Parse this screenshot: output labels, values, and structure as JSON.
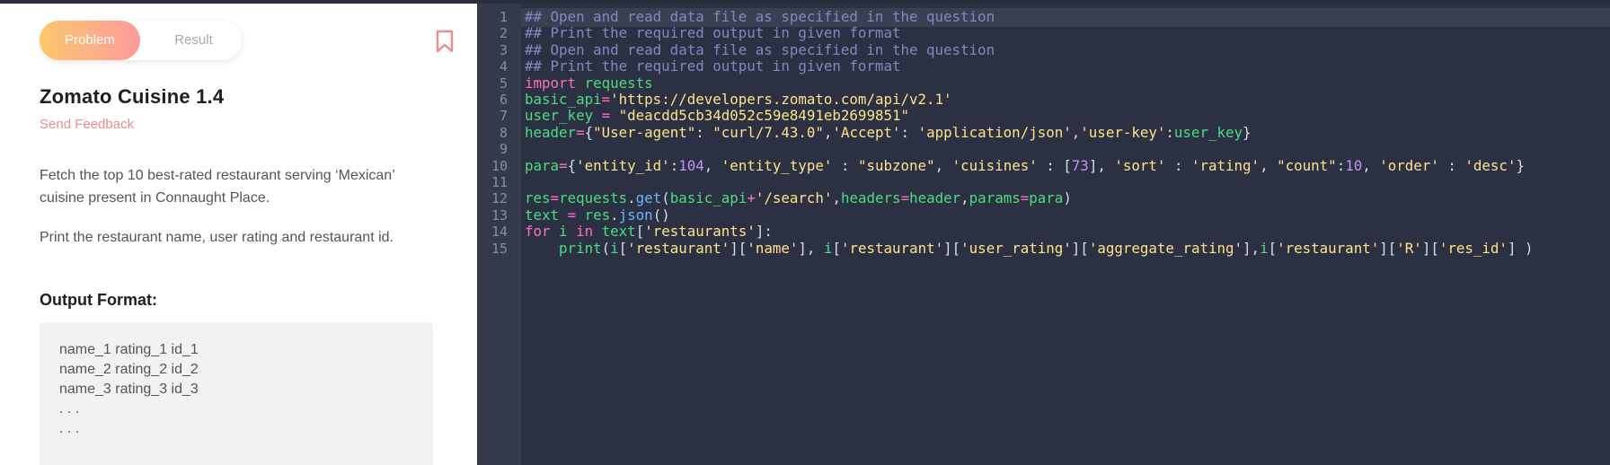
{
  "problem": {
    "tabs": {
      "problem": "Problem",
      "result": "Result"
    },
    "title": "Zomato Cuisine 1.4",
    "feedback": "Send Feedback",
    "description": [
      "Fetch the top 10 best-rated restaurant serving ‘Mexican’ cuisine present in Connaught Place.",
      "Print the restaurant name, user rating and restaurant id."
    ],
    "output_heading": "Output Format:",
    "output_lines": [
      "name_1 rating_1 id_1",
      "name_2 rating_2 id_2",
      "name_3 rating_3 id_3",
      ". . .",
      ". . ."
    ]
  },
  "editor": {
    "line_numbers": [
      "1",
      "2",
      "3",
      "4",
      "5",
      "6",
      "7",
      "8",
      "9",
      "10",
      "11",
      "12",
      "13",
      "14",
      "15"
    ],
    "lines": [
      [
        {
          "t": "## Open and read data file as specified in the question",
          "c": "cm"
        }
      ],
      [
        {
          "t": "## Print the required output in given format",
          "c": "cm"
        }
      ],
      [
        {
          "t": "## Open and read data file as specified in the question",
          "c": "cm"
        }
      ],
      [
        {
          "t": "## Print the required output in given format",
          "c": "cm"
        }
      ],
      [
        {
          "t": "import",
          "c": "kw"
        },
        {
          "t": " requests",
          "c": "nm"
        }
      ],
      [
        {
          "t": "basic_api",
          "c": "nm"
        },
        {
          "t": "=",
          "c": "op"
        },
        {
          "t": "'https://developers.zomato.com/api/v2.1'",
          "c": "st"
        }
      ],
      [
        {
          "t": "user_key ",
          "c": "nm"
        },
        {
          "t": "=",
          "c": "op"
        },
        {
          "t": " \"deacdd5cb34d052c59e8491eb2699851\"",
          "c": "st"
        }
      ],
      [
        {
          "t": "header",
          "c": "nm"
        },
        {
          "t": "=",
          "c": "op"
        },
        {
          "t": "{",
          "c": "pl"
        },
        {
          "t": "\"User-agent\"",
          "c": "st"
        },
        {
          "t": ": ",
          "c": "pl"
        },
        {
          "t": "\"curl/7.43.0\"",
          "c": "st"
        },
        {
          "t": ",",
          "c": "pl"
        },
        {
          "t": "'Accept'",
          "c": "st"
        },
        {
          "t": ": ",
          "c": "pl"
        },
        {
          "t": "'application/json'",
          "c": "st"
        },
        {
          "t": ",",
          "c": "pl"
        },
        {
          "t": "'user-key'",
          "c": "st"
        },
        {
          "t": ":",
          "c": "pl"
        },
        {
          "t": "user_key",
          "c": "nm"
        },
        {
          "t": "}",
          "c": "pl"
        }
      ],
      [],
      [
        {
          "t": "para",
          "c": "nm"
        },
        {
          "t": "=",
          "c": "op"
        },
        {
          "t": "{",
          "c": "pl"
        },
        {
          "t": "'entity_id'",
          "c": "st"
        },
        {
          "t": ":",
          "c": "pl"
        },
        {
          "t": "104",
          "c": "nu"
        },
        {
          "t": ", ",
          "c": "pl"
        },
        {
          "t": "'entity_type'",
          "c": "st"
        },
        {
          "t": " : ",
          "c": "pl"
        },
        {
          "t": "\"subzone\"",
          "c": "st"
        },
        {
          "t": ", ",
          "c": "pl"
        },
        {
          "t": "'cuisines'",
          "c": "st"
        },
        {
          "t": " : [",
          "c": "pl"
        },
        {
          "t": "73",
          "c": "nu"
        },
        {
          "t": "], ",
          "c": "pl"
        },
        {
          "t": "'sort'",
          "c": "st"
        },
        {
          "t": " : ",
          "c": "pl"
        },
        {
          "t": "'rating'",
          "c": "st"
        },
        {
          "t": ", ",
          "c": "pl"
        },
        {
          "t": "\"count\"",
          "c": "st"
        },
        {
          "t": ":",
          "c": "pl"
        },
        {
          "t": "10",
          "c": "nu"
        },
        {
          "t": ", ",
          "c": "pl"
        },
        {
          "t": "'order'",
          "c": "st"
        },
        {
          "t": " : ",
          "c": "pl"
        },
        {
          "t": "'desc'",
          "c": "st"
        },
        {
          "t": "}",
          "c": "pl"
        }
      ],
      [],
      [
        {
          "t": "res",
          "c": "nm"
        },
        {
          "t": "=",
          "c": "op"
        },
        {
          "t": "requests",
          "c": "nm"
        },
        {
          "t": ".",
          "c": "pl"
        },
        {
          "t": "get",
          "c": "fn"
        },
        {
          "t": "(",
          "c": "pl"
        },
        {
          "t": "basic_api",
          "c": "nm"
        },
        {
          "t": "+",
          "c": "op"
        },
        {
          "t": "'/search'",
          "c": "st"
        },
        {
          "t": ",",
          "c": "pl"
        },
        {
          "t": "headers",
          "c": "nm"
        },
        {
          "t": "=",
          "c": "op"
        },
        {
          "t": "header",
          "c": "nm"
        },
        {
          "t": ",",
          "c": "pl"
        },
        {
          "t": "params",
          "c": "nm"
        },
        {
          "t": "=",
          "c": "op"
        },
        {
          "t": "para",
          "c": "nm"
        },
        {
          "t": ")",
          "c": "pl"
        }
      ],
      [
        {
          "t": "text ",
          "c": "nm"
        },
        {
          "t": "=",
          "c": "op"
        },
        {
          "t": " res",
          "c": "nm"
        },
        {
          "t": ".",
          "c": "pl"
        },
        {
          "t": "json",
          "c": "fn"
        },
        {
          "t": "()",
          "c": "pl"
        }
      ],
      [
        {
          "t": "for",
          "c": "kw"
        },
        {
          "t": " i ",
          "c": "nm"
        },
        {
          "t": "in",
          "c": "kw"
        },
        {
          "t": " text",
          "c": "nm"
        },
        {
          "t": "[",
          "c": "pl"
        },
        {
          "t": "'restaurants'",
          "c": "st"
        },
        {
          "t": "]:",
          "c": "pl"
        }
      ],
      [
        {
          "t": "    print",
          "c": "nm"
        },
        {
          "t": "(",
          "c": "pl"
        },
        {
          "t": "i",
          "c": "nm"
        },
        {
          "t": "[",
          "c": "pl"
        },
        {
          "t": "'restaurant'",
          "c": "st"
        },
        {
          "t": "][",
          "c": "pl"
        },
        {
          "t": "'name'",
          "c": "st"
        },
        {
          "t": "], ",
          "c": "pl"
        },
        {
          "t": "i",
          "c": "nm"
        },
        {
          "t": "[",
          "c": "pl"
        },
        {
          "t": "'restaurant'",
          "c": "st"
        },
        {
          "t": "][",
          "c": "pl"
        },
        {
          "t": "'user_rating'",
          "c": "st"
        },
        {
          "t": "][",
          "c": "pl"
        },
        {
          "t": "'aggregate_rating'",
          "c": "st"
        },
        {
          "t": "],",
          "c": "pl"
        },
        {
          "t": "i",
          "c": "nm"
        },
        {
          "t": "[",
          "c": "pl"
        },
        {
          "t": "'restaurant'",
          "c": "st"
        },
        {
          "t": "][",
          "c": "pl"
        },
        {
          "t": "'R'",
          "c": "st"
        },
        {
          "t": "][",
          "c": "pl"
        },
        {
          "t": "'res_id'",
          "c": "st"
        },
        {
          "t": "] )",
          "c": "pl"
        }
      ]
    ]
  },
  "colors": {
    "accent_start": "#fbc86b",
    "accent_end": "#fe9a9e",
    "feedback": "#f08a8a",
    "editor_bg": "#2b3042"
  },
  "icons": {
    "bookmark": "bookmark-icon"
  }
}
